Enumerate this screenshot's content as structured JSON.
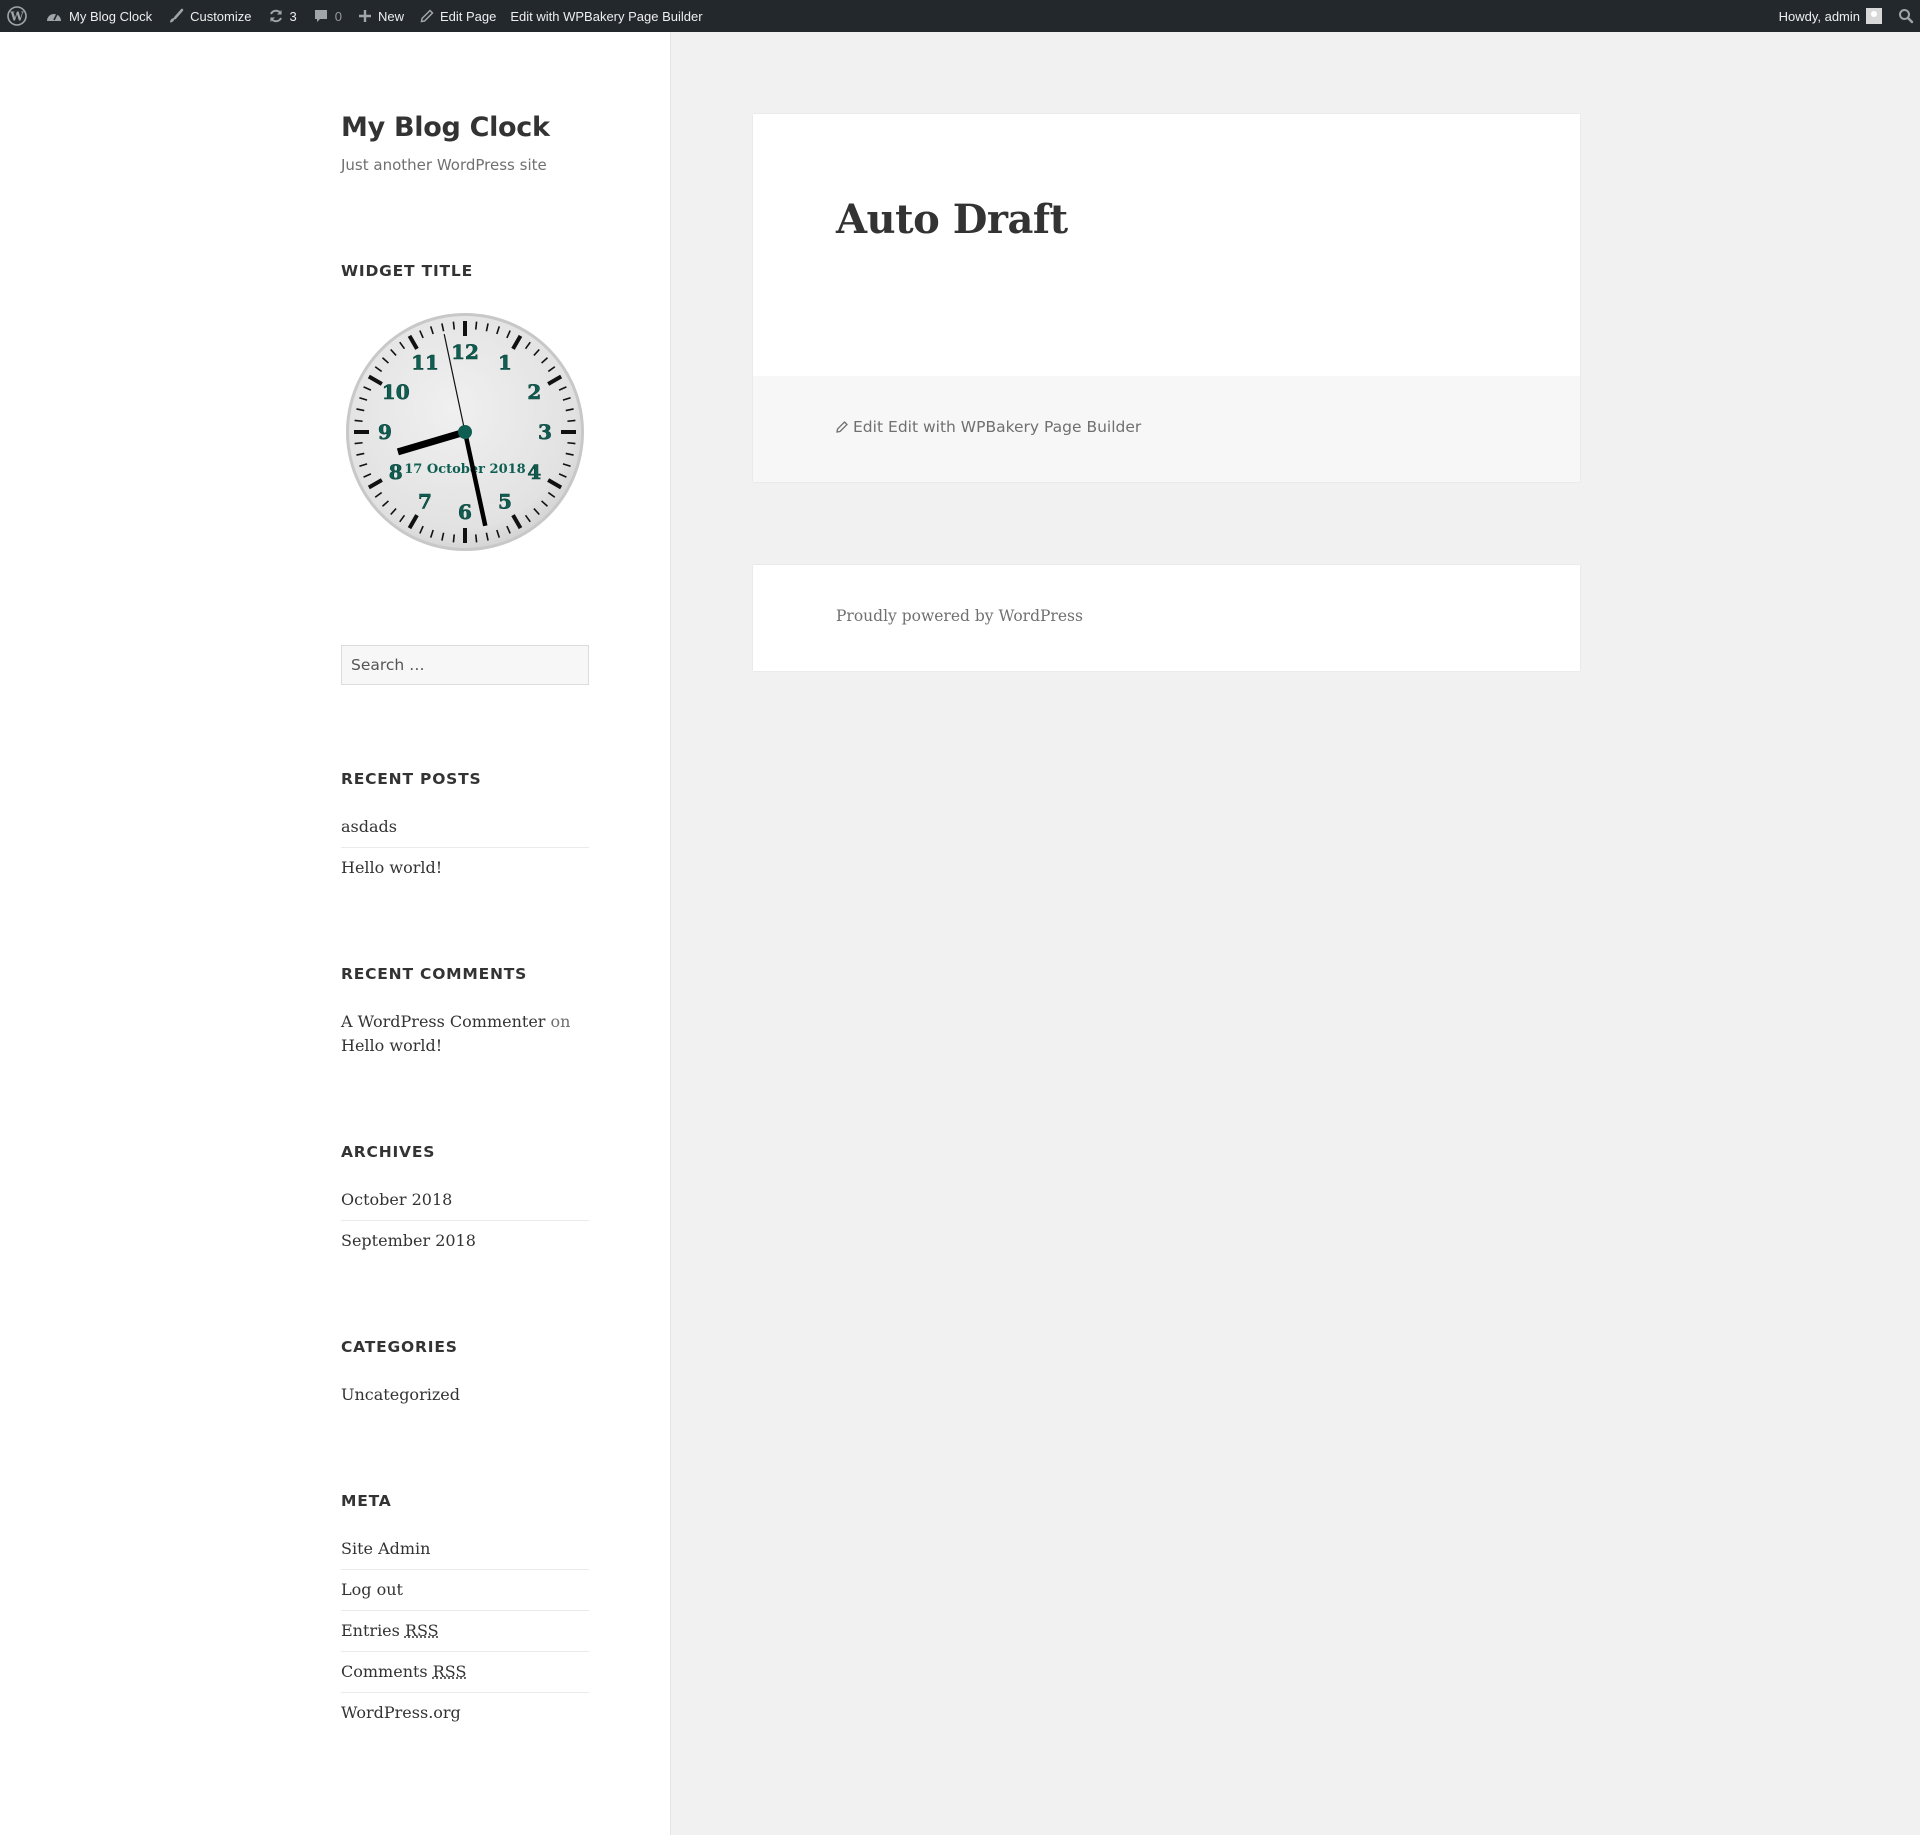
{
  "adminbar": {
    "site_name": "My Blog Clock",
    "customize": "Customize",
    "updates_count": "3",
    "comments_count": "0",
    "new_label": "New",
    "edit_page": "Edit Page",
    "wpbakery": "Edit with WPBakery Page Builder",
    "howdy": "Howdy, admin"
  },
  "sidebar": {
    "site_title": "My Blog Clock",
    "site_description": "Just another WordPress site",
    "clock_widget": {
      "title": "Widget Title",
      "date": "17 October 2018",
      "time_shown": {
        "hour": 8,
        "minute": 27,
        "second": 58
      },
      "numeral_color": "#0e5f52",
      "numerals": [
        "12",
        "1",
        "2",
        "3",
        "4",
        "5",
        "6",
        "7",
        "8",
        "9",
        "10",
        "11"
      ]
    },
    "search_placeholder": "Search …",
    "recent_posts": {
      "title": "Recent Posts",
      "items": [
        "asdads",
        "Hello world!"
      ]
    },
    "recent_comments": {
      "title": "Recent Comments",
      "author": "A WordPress Commenter",
      "on": "on",
      "post": "Hello world!"
    },
    "archives": {
      "title": "Archives",
      "items": [
        "October 2018",
        "September 2018"
      ]
    },
    "categories": {
      "title": "Categories",
      "items": [
        "Uncategorized"
      ]
    },
    "meta": {
      "title": "Meta",
      "site_admin": "Site Admin",
      "log_out": "Log out",
      "entries": "Entries",
      "comments": "Comments",
      "rss": "RSS",
      "wordpress_org": "WordPress.org"
    }
  },
  "article": {
    "title": "Auto Draft",
    "edit": "Edit",
    "wpbakery": "Edit with WPBakery Page Builder"
  },
  "footer": {
    "powered_by": "Proudly powered by WordPress"
  }
}
